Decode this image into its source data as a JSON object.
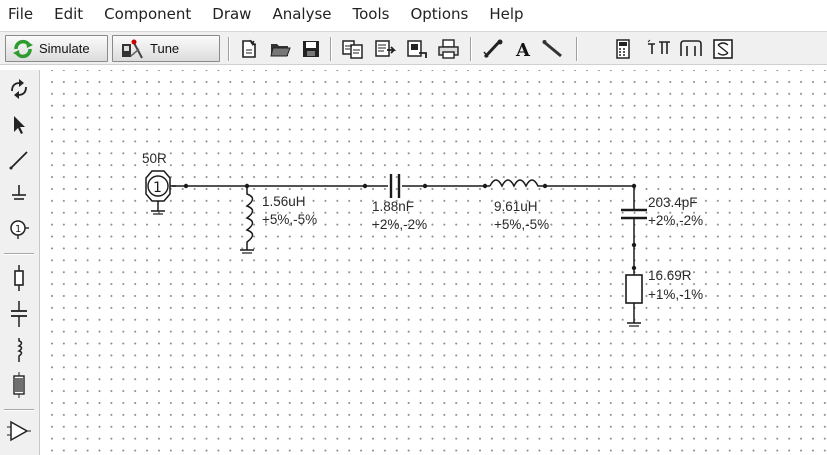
{
  "menu": {
    "items": [
      {
        "label": "File"
      },
      {
        "label": "Edit"
      },
      {
        "label": "Component"
      },
      {
        "label": "Draw"
      },
      {
        "label": "Analyse"
      },
      {
        "label": "Tools"
      },
      {
        "label": "Options"
      },
      {
        "label": "Help"
      }
    ]
  },
  "toolbar": {
    "simulate_label": "Simulate",
    "tune_label": "Tune"
  },
  "schematic": {
    "source": {
      "impedance": "50R",
      "port_number": "1"
    },
    "shunt_inductor": {
      "value": "1.56uH",
      "tolerance": "+5%,-5%"
    },
    "series_capacitor": {
      "value": "1.88nF",
      "tolerance": "+2%,-2%"
    },
    "series_inductor": {
      "value": "9.61uH",
      "tolerance": "+5%,-5%"
    },
    "shunt_capacitor": {
      "value": "203.4pF",
      "tolerance": "+2%,-2%"
    },
    "load_resistor": {
      "value": "16.69R",
      "tolerance": "+1%,-1%"
    }
  },
  "colors": {
    "wire": "#1a1a1a",
    "grid_dot": "#8c8c8c",
    "toolbar_bg": "#f0f0f0",
    "simulate_icon": "#2e9b2e"
  }
}
